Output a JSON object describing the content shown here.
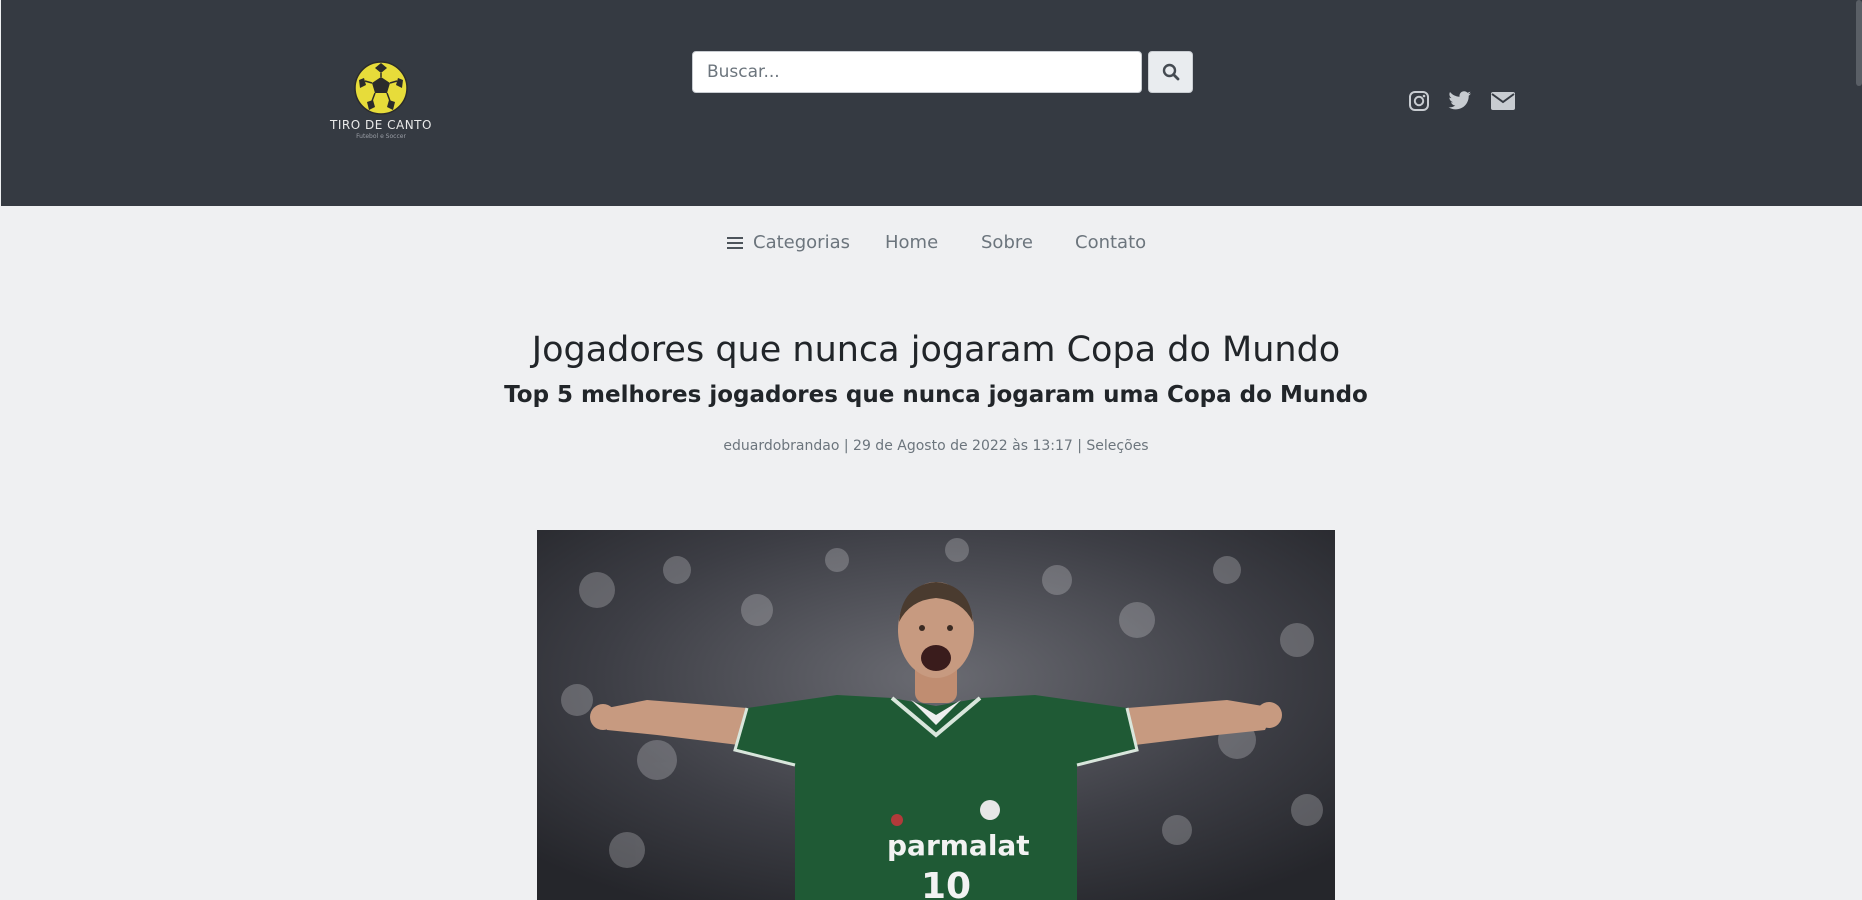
{
  "brand": {
    "name": "TIRO DE CANTO",
    "tagline": "Futebol e Soccer",
    "logo_color": "#e7dc3a"
  },
  "search": {
    "placeholder": "Buscar...",
    "button_icon": "search-icon"
  },
  "social": [
    {
      "icon": "instagram-icon"
    },
    {
      "icon": "twitter-icon"
    },
    {
      "icon": "envelope-icon"
    }
  ],
  "nav": {
    "categories_label": "Categorias",
    "home_label": "Home",
    "about_label": "Sobre",
    "contact_label": "Contato"
  },
  "article": {
    "title": "Jogadores que nunca jogaram Copa do Mundo",
    "subtitle": "Top 5 melhores jogadores que nunca jogaram uma Copa do Mundo",
    "author": "eduardobrandao",
    "separator": "|",
    "date": "29 de Agosto de 2022 às 13:17",
    "category": "Seleções"
  },
  "hero_image": {
    "jersey_sponsor": "parmalat",
    "jersey_number": "10"
  },
  "colors": {
    "header_bg": "#353a42",
    "page_bg": "#eff0f2",
    "jersey_green": "#1f5a35"
  }
}
